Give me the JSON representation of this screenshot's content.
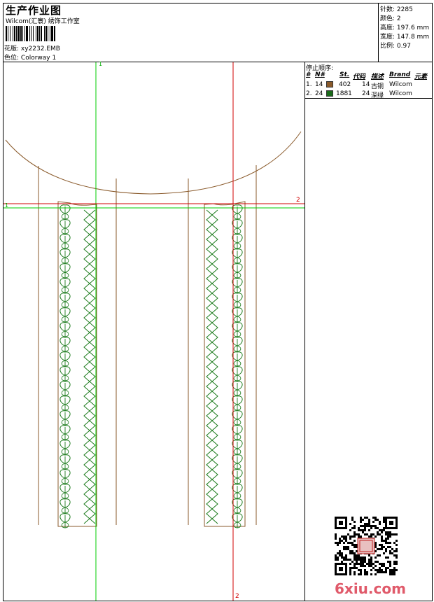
{
  "header": {
    "title": "生产作业图",
    "company": "Wilcom(汇寰) 绣饰工作室",
    "design_label": "花版:",
    "design_value": "xy2232.EMB",
    "colorway_label": "色位:",
    "colorway_value": "Colorway 1"
  },
  "stats": [
    {
      "label": "针数:",
      "value": "2285"
    },
    {
      "label": "颜色:",
      "value": "2"
    },
    {
      "label": "高度:",
      "value": "197.6 mm"
    },
    {
      "label": "宽度:",
      "value": "147.8 mm"
    },
    {
      "label": "比例:",
      "value": "0.97"
    }
  ],
  "stop_sequence": {
    "title": "停止顺序:",
    "columns": [
      "#",
      "N#",
      "St.",
      "代码",
      "描述",
      "Brand",
      "元素"
    ],
    "rows": [
      {
        "idx": "1.",
        "needle": "14",
        "color": "#8a5a2b",
        "stitches": "402",
        "code": "14",
        "desc": "古铜",
        "brand": "Wilcom"
      },
      {
        "idx": "2.",
        "needle": "24",
        "color": "#1a6b1a",
        "stitches": "1881",
        "code": "24",
        "desc": "深绿",
        "brand": "Wilcom"
      }
    ]
  },
  "guides": {
    "green_v": "1",
    "green_h": "1",
    "red_h": "2",
    "red_v": "2"
  },
  "watermark": "6xiu.com",
  "colors": {
    "brown": "#8a5a2b",
    "green": "#1a7a1a",
    "red": "#d00000",
    "guide_green": "#00cc00"
  }
}
